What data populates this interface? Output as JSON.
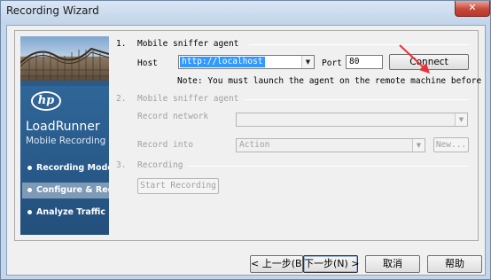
{
  "window": {
    "title": "Recording Wizard",
    "close_glyph": "✕"
  },
  "brand": {
    "logo_text": "hp",
    "product_name": "LoadRunner",
    "product_sub": "Mobile Recording",
    "steps": [
      {
        "label": "Recording Mode",
        "active": false
      },
      {
        "label": "Configure & Record",
        "active": true
      },
      {
        "label": "Analyze Traffic",
        "active": false
      }
    ]
  },
  "section1": {
    "number": "1.",
    "title": "Mobile sniffer agent",
    "host_label": "Host",
    "host_value": "http://localhost",
    "port_label": "Port",
    "port_value": "80",
    "connect_label": "Connect",
    "note": "Note: You must launch the agent on the remote machine before"
  },
  "section2": {
    "number": "2.",
    "title": "Mobile sniffer agent",
    "record_network_label": "Record network",
    "record_network_value": "",
    "record_into_label": "Record into",
    "record_into_value": "Action",
    "new_label": "New..."
  },
  "section3": {
    "number": "3.",
    "title": "Recording",
    "start_label": "Start Recording"
  },
  "footer": {
    "back_label": "< 上一步(B)",
    "next_label": "下一步(N) >",
    "cancel_label": "取消",
    "help_label": "帮助"
  },
  "colors": {
    "annotation_arrow": "#e8333a",
    "brand_panel": "#2b5a88",
    "selection": "#3399ff"
  },
  "icons": {
    "dropdown": "chevron-down-icon",
    "step_bullet": "bullet-icon",
    "annotation": "red-arrow-icon"
  }
}
